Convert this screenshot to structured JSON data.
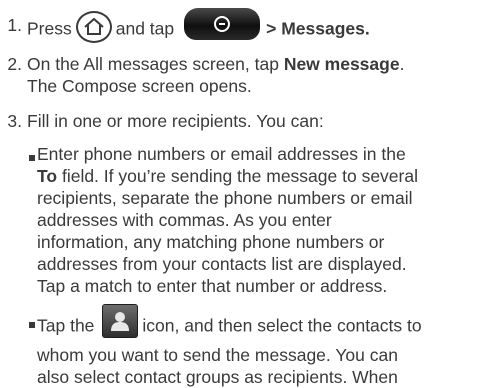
{
  "steps": [
    {
      "num": "1.",
      "pre": "Press",
      "mid": "and tap",
      "post": "> Messages."
    },
    {
      "num": "2.",
      "lines": [
        [
          "On the All messages screen, tap ",
          "New message",
          "."
        ],
        [
          "The Compose screen opens."
        ]
      ]
    },
    {
      "num": "3.",
      "text": "Fill in one or more recipients. You can:"
    }
  ],
  "bullets": [
    {
      "lines": [
        [
          "Enter phone numbers or email addresses in the"
        ],
        [
          "",
          "To",
          " field. If you’re sending the message to several"
        ],
        [
          "recipients, separate the phone numbers or email"
        ],
        [
          "addresses with commas. As you enter"
        ],
        [
          "information, any matching phone numbers or"
        ],
        [
          "addresses from your contacts list are displayed."
        ],
        [
          "Tap a match to enter that number or address."
        ]
      ]
    },
    {
      "pre": "Tap the",
      "post": "icon, and then select the contacts to",
      "lines": [
        [
          "whom you want to send the message. You can"
        ],
        [
          "also select contact groups as recipients. When"
        ]
      ]
    }
  ],
  "icons": {
    "home": "home-icon",
    "menu": "menu-key-icon",
    "contact": "contact-icon"
  }
}
